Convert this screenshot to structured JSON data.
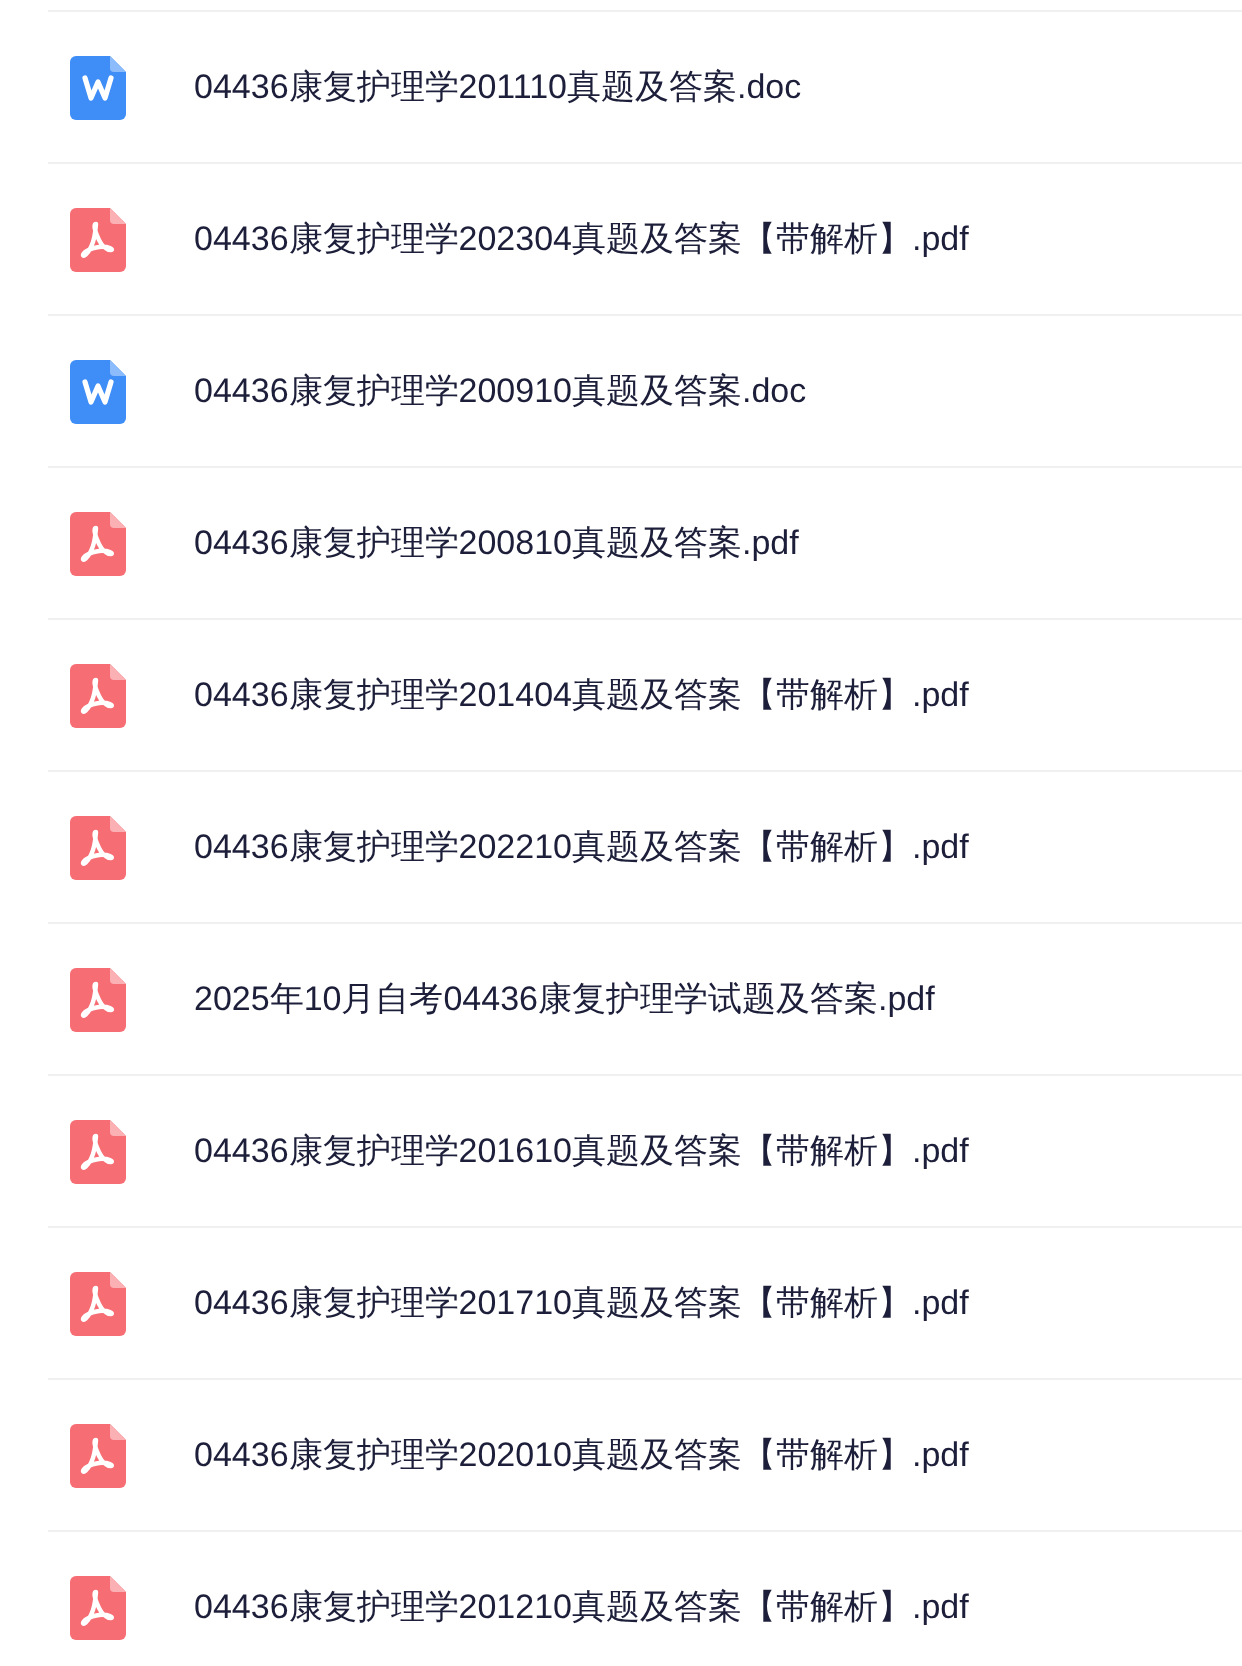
{
  "files": [
    {
      "kind": "doc",
      "name": "04436康复护理学201110真题及答案.doc"
    },
    {
      "kind": "pdf",
      "name": "04436康复护理学202304真题及答案【带解析】.pdf"
    },
    {
      "kind": "doc",
      "name": "04436康复护理学200910真题及答案.doc"
    },
    {
      "kind": "pdf",
      "name": "04436康复护理学200810真题及答案.pdf"
    },
    {
      "kind": "pdf",
      "name": "04436康复护理学201404真题及答案【带解析】.pdf"
    },
    {
      "kind": "pdf",
      "name": "04436康复护理学202210真题及答案【带解析】.pdf"
    },
    {
      "kind": "pdf",
      "name": "2025年10月自考04436康复护理学试题及答案.pdf"
    },
    {
      "kind": "pdf",
      "name": "04436康复护理学201610真题及答案【带解析】.pdf"
    },
    {
      "kind": "pdf",
      "name": "04436康复护理学201710真题及答案【带解析】.pdf"
    },
    {
      "kind": "pdf",
      "name": "04436康复护理学202010真题及答案【带解析】.pdf"
    },
    {
      "kind": "pdf",
      "name": "04436康复护理学201210真题及答案【带解析】.pdf"
    }
  ]
}
